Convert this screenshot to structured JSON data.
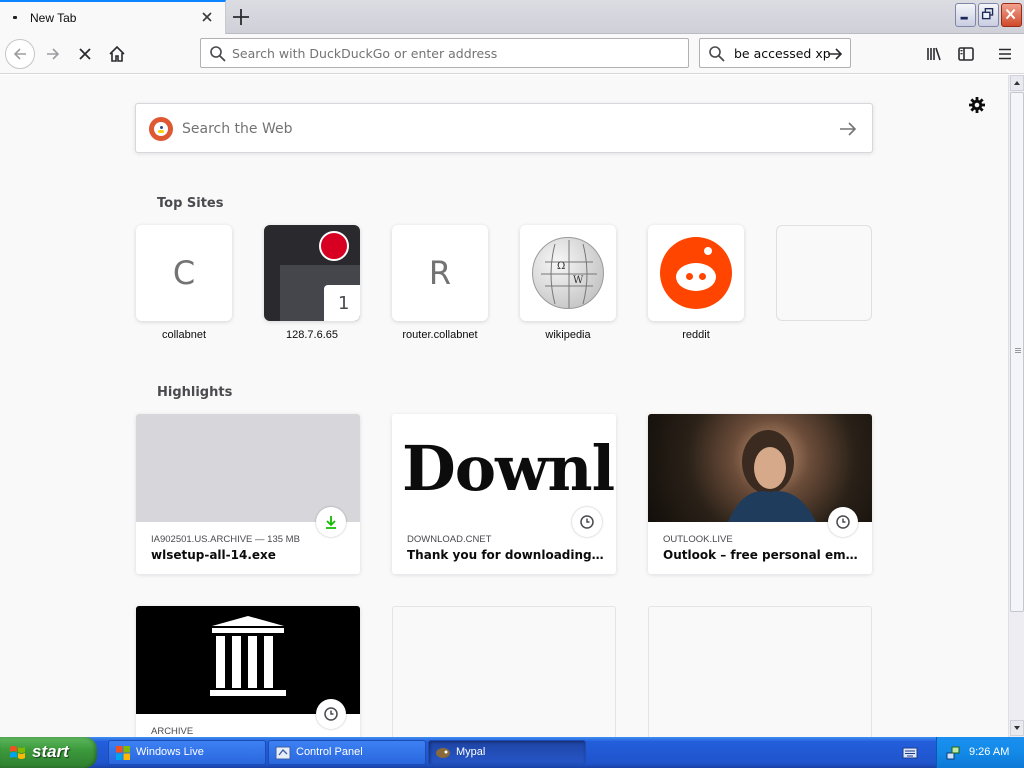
{
  "browser": {
    "tab": {
      "title": "New Tab"
    },
    "urlbar": {
      "placeholder": "Search with DuckDuckGo or enter address"
    },
    "searchbar": {
      "value": "be accessed xp"
    }
  },
  "newtab": {
    "search": {
      "placeholder": "Search the Web"
    },
    "top_sites_title": "Top Sites",
    "top_sites": [
      {
        "label": "collabnet",
        "letter": "C"
      },
      {
        "label": "128.7.6.65",
        "badge": "1"
      },
      {
        "label": "router.collabnet",
        "letter": "R"
      },
      {
        "label": "wikipedia"
      },
      {
        "label": "reddit"
      },
      {
        "label": ""
      }
    ],
    "highlights_title": "Highlights",
    "highlights": [
      {
        "source": "IA902501.US.ARCHIVE — 135 MB",
        "title": "wlsetup-all-14.exe",
        "icon": "download-icon"
      },
      {
        "source": "DOWNLOAD.CNET",
        "title": "Thank you for downloading Win…",
        "thumb_text": "Downl",
        "icon": "clock-icon"
      },
      {
        "source": "OUTLOOK.LIVE",
        "title": "Outlook – free personal email an…",
        "icon": "clock-icon"
      },
      {
        "source": "ARCHIVE",
        "title": "",
        "icon": "clock-icon"
      }
    ]
  },
  "taskbar": {
    "start_label": "start",
    "buttons": [
      {
        "label": "Windows Live"
      },
      {
        "label": "Control Panel"
      },
      {
        "label": "Mypal"
      }
    ],
    "clock": "9:26 AM"
  },
  "colors": {
    "accent": "#0a84ff",
    "download_green": "#12bc00",
    "reddit_orange": "#ff4500",
    "ddg_orange": "#de5833"
  }
}
